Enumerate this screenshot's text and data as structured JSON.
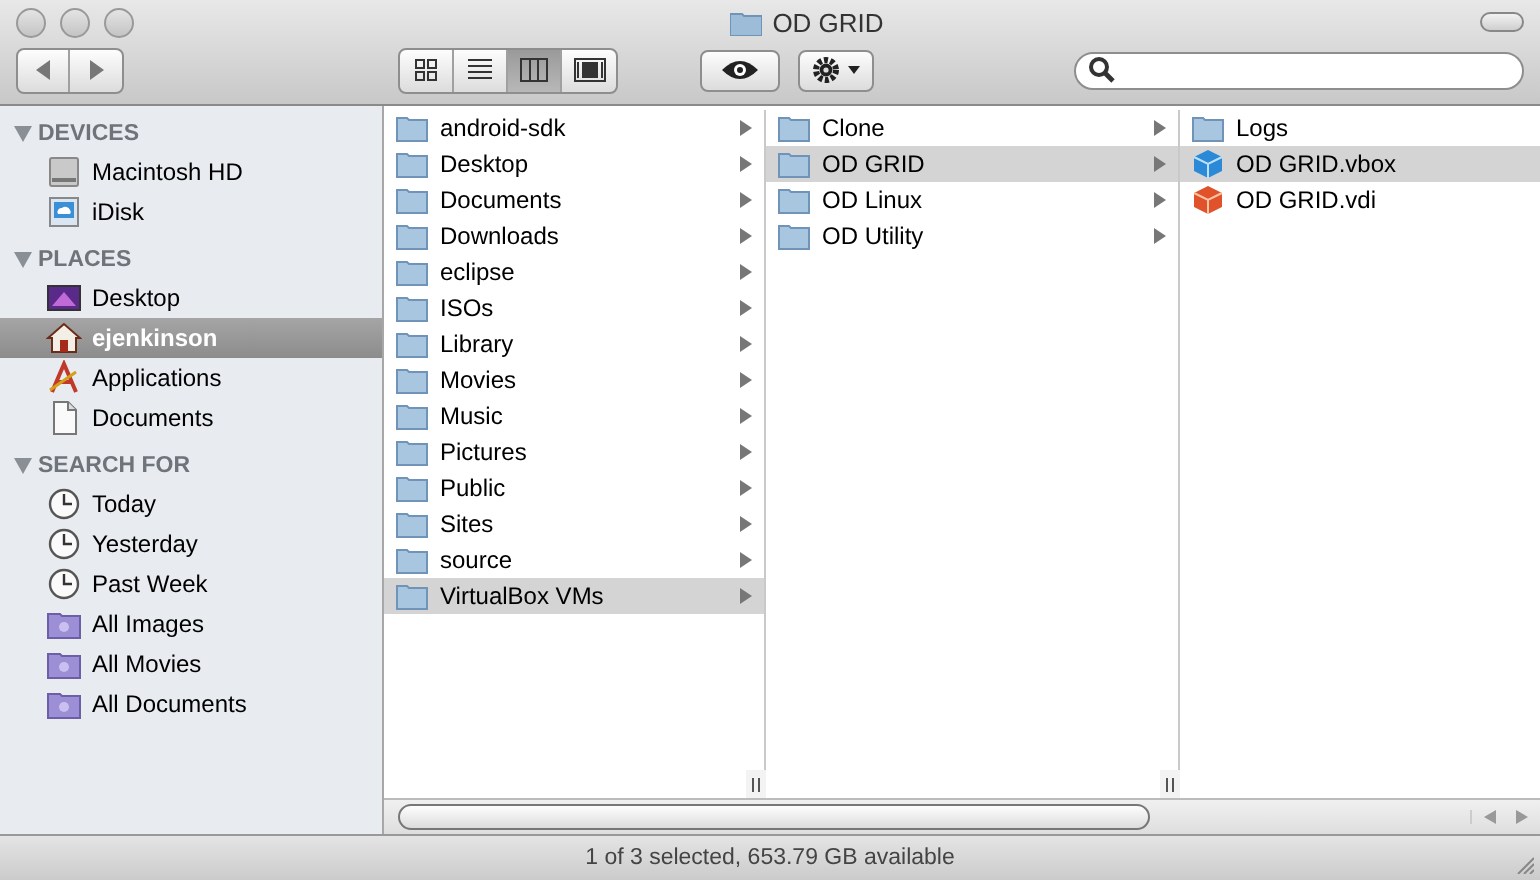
{
  "window": {
    "title": "OD GRID"
  },
  "toolbar": {
    "views": [
      {
        "kind": "icons",
        "selected": false
      },
      {
        "kind": "list",
        "selected": false
      },
      {
        "kind": "columns",
        "selected": true
      },
      {
        "kind": "coverflow",
        "selected": false
      }
    ]
  },
  "sidebar": {
    "sections": [
      {
        "title": "DEVICES",
        "items": [
          {
            "label": "Macintosh HD",
            "kind": "disk",
            "selected": false
          },
          {
            "label": "iDisk",
            "kind": "idisk",
            "selected": false
          }
        ]
      },
      {
        "title": "PLACES",
        "items": [
          {
            "label": "Desktop",
            "kind": "desktop",
            "selected": false
          },
          {
            "label": "ejenkinson",
            "kind": "home",
            "selected": true
          },
          {
            "label": "Applications",
            "kind": "apps",
            "selected": false
          },
          {
            "label": "Documents",
            "kind": "doc",
            "selected": false
          }
        ]
      },
      {
        "title": "SEARCH FOR",
        "items": [
          {
            "label": "Today",
            "kind": "clock",
            "selected": false
          },
          {
            "label": "Yesterday",
            "kind": "clock",
            "selected": false
          },
          {
            "label": "Past Week",
            "kind": "clock",
            "selected": false
          },
          {
            "label": "All Images",
            "kind": "smart",
            "selected": false
          },
          {
            "label": "All Movies",
            "kind": "smart",
            "selected": false
          },
          {
            "label": "All Documents",
            "kind": "smart",
            "selected": false
          }
        ]
      }
    ]
  },
  "columns": [
    {
      "items": [
        {
          "name": "android-sdk",
          "kind": "folder",
          "expandable": true,
          "selected": false
        },
        {
          "name": "Desktop",
          "kind": "folder",
          "expandable": true,
          "selected": false
        },
        {
          "name": "Documents",
          "kind": "folder",
          "expandable": true,
          "selected": false
        },
        {
          "name": "Downloads",
          "kind": "folder",
          "expandable": true,
          "selected": false
        },
        {
          "name": "eclipse",
          "kind": "folder",
          "expandable": true,
          "selected": false
        },
        {
          "name": "ISOs",
          "kind": "folder",
          "expandable": true,
          "selected": false
        },
        {
          "name": "Library",
          "kind": "folder",
          "expandable": true,
          "selected": false
        },
        {
          "name": "Movies",
          "kind": "folder",
          "expandable": true,
          "selected": false
        },
        {
          "name": "Music",
          "kind": "folder",
          "expandable": true,
          "selected": false
        },
        {
          "name": "Pictures",
          "kind": "folder",
          "expandable": true,
          "selected": false
        },
        {
          "name": "Public",
          "kind": "folder",
          "expandable": true,
          "selected": false
        },
        {
          "name": "Sites",
          "kind": "folder",
          "expandable": true,
          "selected": false
        },
        {
          "name": "source",
          "kind": "folder",
          "expandable": true,
          "selected": false
        },
        {
          "name": "VirtualBox VMs",
          "kind": "folder",
          "expandable": true,
          "selected": true
        }
      ]
    },
    {
      "items": [
        {
          "name": "Clone",
          "kind": "folder",
          "expandable": true,
          "selected": false
        },
        {
          "name": "OD GRID",
          "kind": "folder",
          "expandable": true,
          "selected": true
        },
        {
          "name": "OD Linux",
          "kind": "folder",
          "expandable": true,
          "selected": false
        },
        {
          "name": "OD Utility",
          "kind": "folder",
          "expandable": true,
          "selected": false
        }
      ]
    },
    {
      "items": [
        {
          "name": "Logs",
          "kind": "folder",
          "expandable": false,
          "selected": false
        },
        {
          "name": "OD GRID.vbox",
          "kind": "vbox",
          "expandable": false,
          "selected": true
        },
        {
          "name": "OD GRID.vdi",
          "kind": "vdi",
          "expandable": false,
          "selected": false
        }
      ]
    }
  ],
  "status_bar": "1 of 3 selected, 653.79 GB available"
}
